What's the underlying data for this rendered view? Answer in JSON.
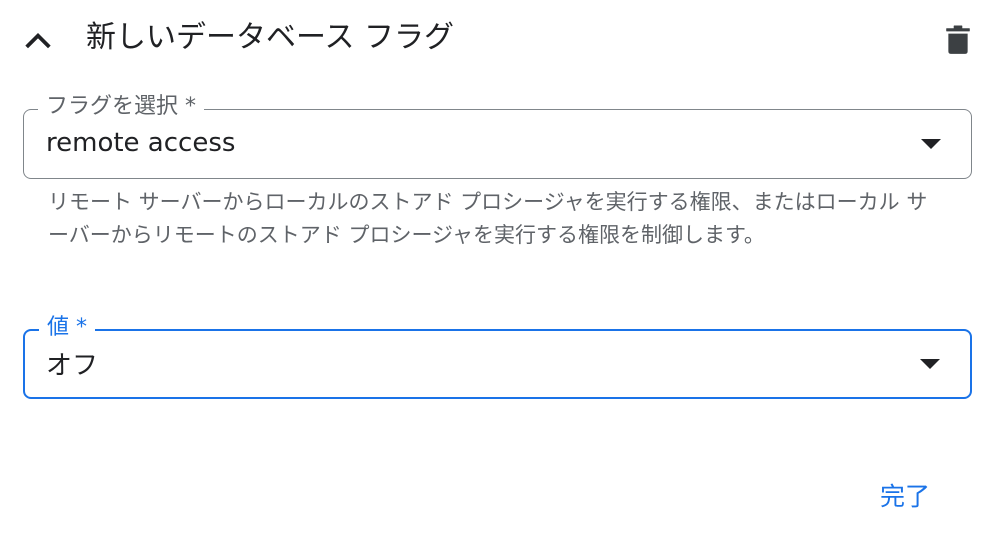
{
  "header": {
    "title": "新しいデータベース フラグ",
    "collapse_icon": "chevron-up-icon",
    "delete_icon": "trash-icon"
  },
  "flag_field": {
    "label": "フラグを選択 *",
    "value": "remote access",
    "helper_text": "リモート サーバーからローカルのストアド プロシージャを実行する権限、またはローカル サーバーからリモートのストアド プロシージャを実行する権限を制御します。"
  },
  "value_field": {
    "label": "値 *",
    "value": "オフ"
  },
  "actions": {
    "done_label": "完了"
  },
  "colors": {
    "accent": "#1a73e8",
    "text": "#202124",
    "secondary_text": "#5f6368",
    "border": "#80868b"
  }
}
